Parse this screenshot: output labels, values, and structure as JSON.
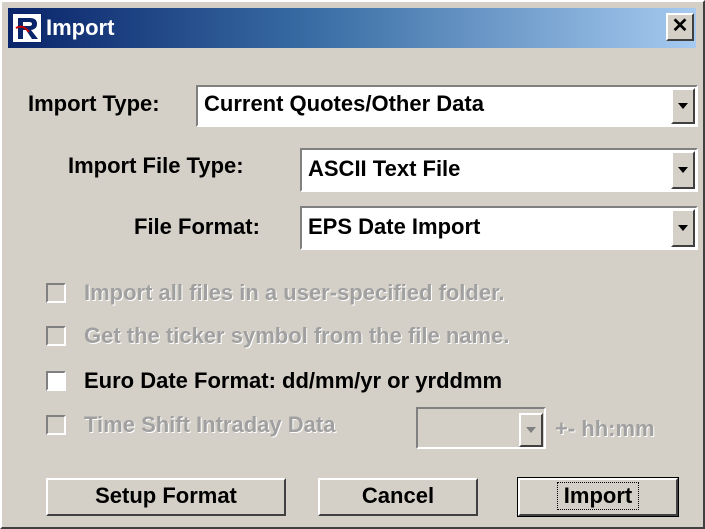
{
  "window": {
    "title": "Import",
    "close_glyph": "✕"
  },
  "fields": {
    "import_type": {
      "label": "Import Type:",
      "value": "Current Quotes/Other Data"
    },
    "import_file_type": {
      "label": "Import File Type:",
      "value": "ASCII Text File"
    },
    "file_format": {
      "label": "File Format:",
      "value": "EPS Date Import"
    }
  },
  "options": {
    "all_files": {
      "label": "Import all files in a user-specified folder.",
      "checked": false,
      "enabled": false
    },
    "ticker_from_name": {
      "label": "Get the ticker symbol from the file name.",
      "checked": false,
      "enabled": false
    },
    "euro_date": {
      "label": "Euro Date Format: dd/mm/yr or yrddmm",
      "checked": false,
      "enabled": true
    },
    "time_shift": {
      "label": "Time Shift Intraday Data",
      "checked": false,
      "enabled": false,
      "value": "",
      "suffix": "+- hh:mm"
    }
  },
  "buttons": {
    "setup": "Setup Format",
    "cancel": "Cancel",
    "import": "Import"
  },
  "icons": {
    "app": "app-logo-icon",
    "close": "close-icon",
    "dropdown": "chevron-down-icon"
  }
}
